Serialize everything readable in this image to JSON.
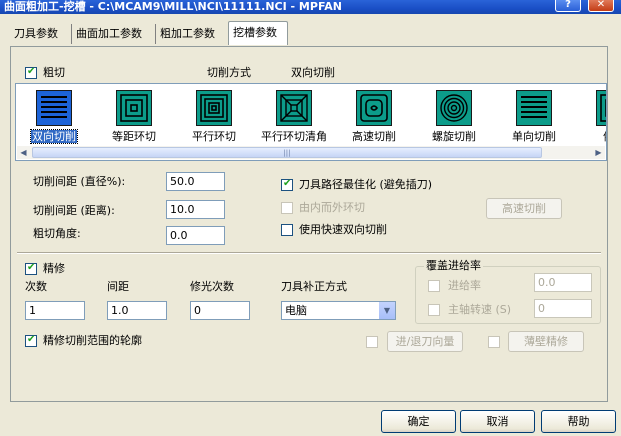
{
  "window": {
    "title": "曲面粗加工-挖槽 - C:\\MCAM9\\MILL\\NCI\\11111.NCI - MPFAN",
    "help": "?",
    "close": "✕"
  },
  "tabs": [
    "刀具参数",
    "曲面加工参数",
    "粗加工参数",
    "挖槽参数"
  ],
  "active_tab_index": 3,
  "rough": {
    "enabled_label": "粗切",
    "enabled": true,
    "cut_method_label": "切削方式",
    "cut_method_value": "双向切削",
    "patterns": [
      {
        "label": "双向切削",
        "icon": "zigzag-icon",
        "selected": true
      },
      {
        "label": "等距环切",
        "icon": "constant-overlap-spiral-icon",
        "selected": false
      },
      {
        "label": "平行环切",
        "icon": "parallel-spiral-icon",
        "selected": false
      },
      {
        "label": "平行环切清角",
        "icon": "parallel-spiral-clean-corners-icon",
        "selected": false
      },
      {
        "label": "高速切削",
        "icon": "high-speed-icon",
        "selected": false
      },
      {
        "label": "螺旋切削",
        "icon": "true-spiral-icon",
        "selected": false
      },
      {
        "label": "单向切削",
        "icon": "one-way-icon",
        "selected": false
      },
      {
        "label": "依外",
        "icon": "morph-spiral-icon",
        "selected": false
      }
    ],
    "stepover_pct_label": "切削间距 (直径%):",
    "stepover_pct_value": "50.0",
    "stepover_dist_label": "切削间距 (距离):",
    "stepover_dist_value": "10.0",
    "rough_angle_label": "粗切角度:",
    "rough_angle_value": "0.0",
    "minimize_burial_label": "刀具路径最佳化 (避免插刀)",
    "minimize_burial": true,
    "spiral_inside_out_label": "由内而外环切",
    "use_quick_zigzag_label": "使用快速双向切削",
    "high_speed_button": "高速切削"
  },
  "finish": {
    "enabled_label": "精修",
    "enabled": true,
    "passes_label": "次数",
    "passes_value": "1",
    "spacing_label": "间距",
    "spacing_value": "1.0",
    "spring_passes_label": "修光次数",
    "spring_passes_value": "0",
    "comp_label": "刀具补正方式",
    "comp_value": "电脑",
    "finish_outer_label": "精修切削范围的轮廓",
    "finish_outer": true,
    "override_group_label": "覆盖进给率",
    "feed_rate_label": "进给率",
    "feed_rate_value": "0.0",
    "spindle_label": "主轴转速 (S)",
    "spindle_value": "0",
    "lead_button": "进/退刀向量",
    "thin_wall_button": "薄壁精修"
  },
  "buttons": {
    "ok": "确定",
    "cancel": "取消",
    "help": "帮助"
  }
}
